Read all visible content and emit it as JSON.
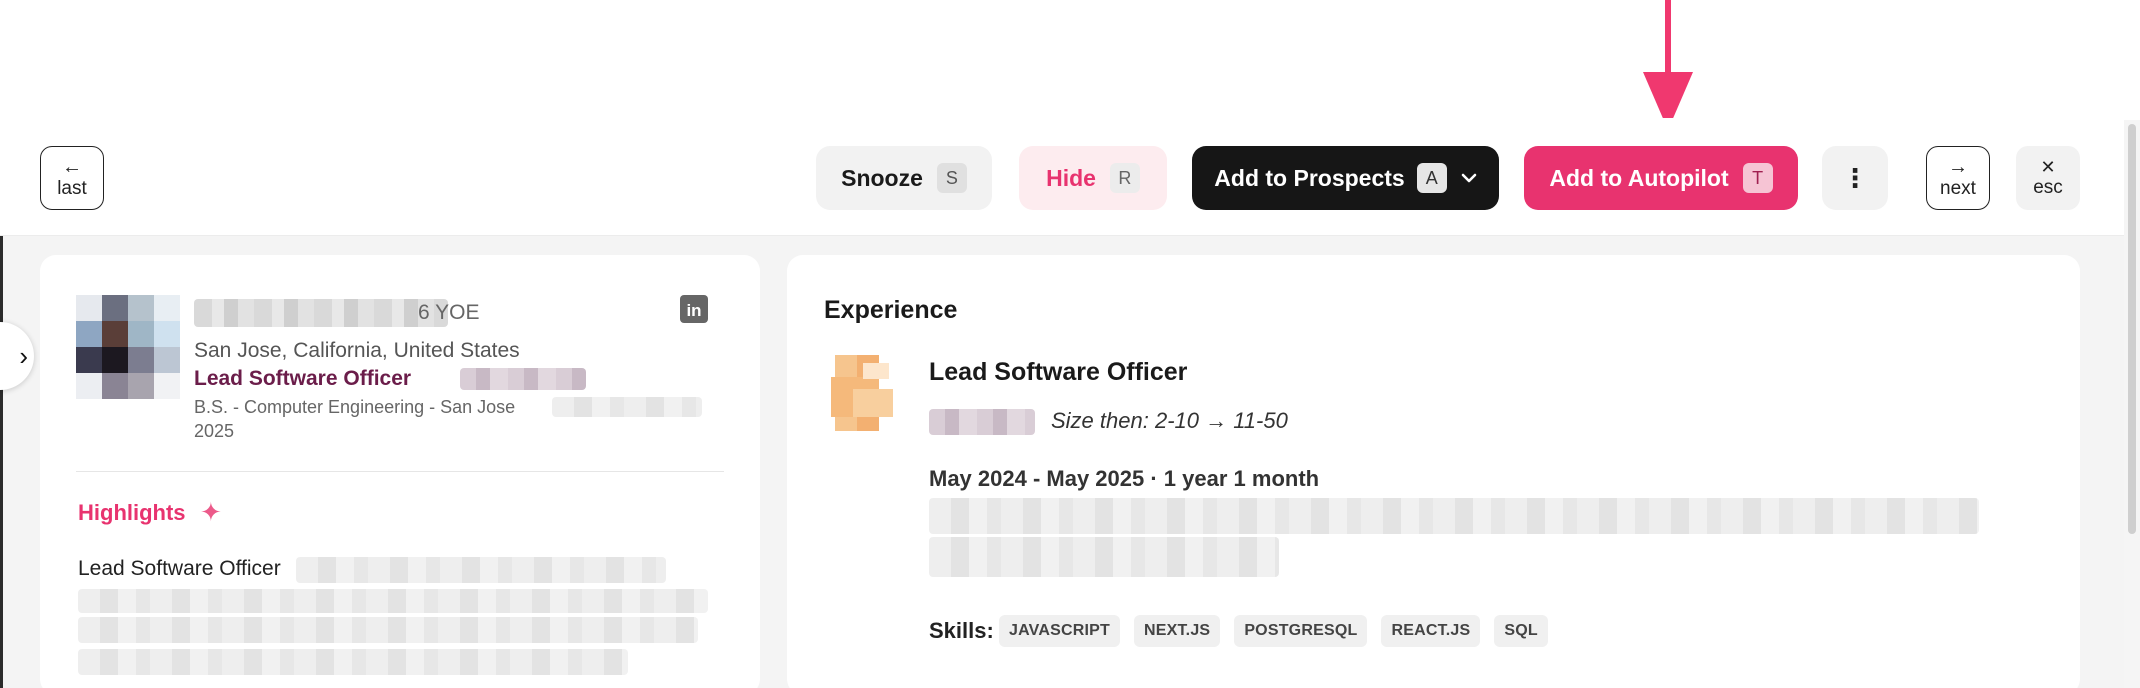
{
  "toolbar": {
    "last": {
      "label": "last",
      "icon": "arrow-left-icon",
      "glyph": "←"
    },
    "snooze": {
      "label": "Snooze",
      "shortcut": "S"
    },
    "hide": {
      "label": "Hide",
      "shortcut": "R"
    },
    "prospects": {
      "label": "Add to Prospects",
      "shortcut": "A",
      "chevron": "⌄"
    },
    "autopilot": {
      "label": "Add to Autopilot",
      "shortcut": "T"
    },
    "more": {
      "glyph": "⋮",
      "icon": "more-vertical-icon"
    },
    "next": {
      "label": "next",
      "icon": "arrow-right-icon",
      "glyph": "→"
    },
    "esc": {
      "label": "esc",
      "icon": "close-icon",
      "glyph": "✕"
    }
  },
  "sidebar_toggle": {
    "glyph": "›"
  },
  "profile": {
    "yoe": "6 YOE",
    "location": "San Jose, California, United States",
    "title": "Lead Software Officer",
    "education": "B.S. - Computer Engineering - San Jose",
    "education_year": "2025",
    "linkedin_glyph": "in"
  },
  "highlights": {
    "title": "Highlights",
    "sparkle": "✦",
    "text": "Lead Software Officer"
  },
  "experience": {
    "heading": "Experience",
    "role": "Lead Software Officer",
    "size": "Size then: 2-10 → 11-50",
    "dates": "May 2024 - May 2025 · 1 year 1 month",
    "skills_label": "Skills:",
    "skills": [
      "JAVASCRIPT",
      "NEXT.JS",
      "POSTGRESQL",
      "REACT.JS",
      "SQL"
    ]
  },
  "colors": {
    "accent": "#e8336f",
    "dark_button": "#161616",
    "title_maroon": "#6b1d4a",
    "background": "#f4f4f4"
  }
}
